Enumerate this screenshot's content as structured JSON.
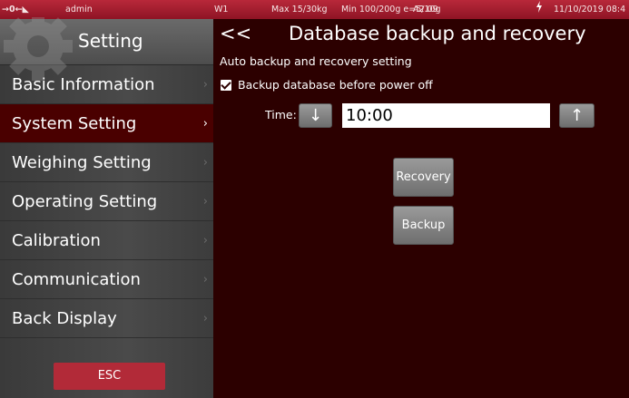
{
  "statusbar": {
    "zero_indicator": "→0←◣",
    "user": "admin",
    "scale": "W1",
    "max": "Max 15/30kg",
    "min": "Min 100/200g e=5/10g",
    "version": "A2.09",
    "power_icon": "bolt-icon",
    "datetime": "11/10/2019 08:4"
  },
  "sidebar": {
    "title": "Setting",
    "items": [
      {
        "label": "Basic Information"
      },
      {
        "label": "System Setting"
      },
      {
        "label": "Weighing Setting"
      },
      {
        "label": "Operating Setting"
      },
      {
        "label": "Calibration"
      },
      {
        "label": "Communication"
      },
      {
        "label": "Back Display"
      }
    ],
    "active_index": 1,
    "chevron": "›",
    "esc_label": "ESC"
  },
  "main": {
    "back_label": "<<",
    "title": "Database backup and recovery",
    "section_label": "Auto backup and recovery setting",
    "checkbox_label": "Backup database before power off",
    "checkbox_checked": true,
    "time_label": "Time:",
    "time_value": "10:00",
    "down_arrow": "↓",
    "up_arrow": "↑",
    "recovery_label": "Recovery",
    "backup_label": "Backup"
  },
  "colors": {
    "statusbar": "#a41e30",
    "sidebar": "#444444",
    "active_item": "#4a0000",
    "main_bg": "#2c0000",
    "esc_button": "#b22a38"
  }
}
